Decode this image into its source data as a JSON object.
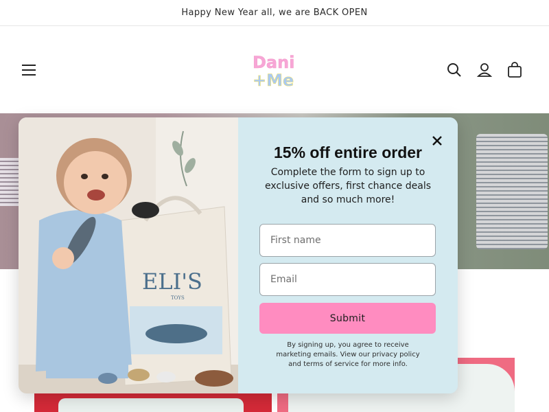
{
  "announcement": {
    "text": "Happy New Year all, we are BACK OPEN"
  },
  "header": {
    "logo_line1": "Dani",
    "logo_line2": "+Me",
    "icons": [
      "menu-icon",
      "search-icon",
      "account-icon",
      "cart-icon"
    ]
  },
  "popup": {
    "title": "15% off entire order",
    "subtitle": "Complete the form to sign up to exclusive offers, first chance deals and so much more!",
    "first_name_placeholder": "First name",
    "email_placeholder": "Email",
    "submit_label": "Submit",
    "legal": "By signing up, you agree to receive marketing emails. View our privacy policy and terms of service for more info.",
    "image_bag_text": "ELI'S",
    "image_bag_subtext": "TOYS"
  },
  "colors": {
    "popup_bg": "#d4eaf0",
    "submit_bg": "#ff8cc0",
    "logo_pink": "#f7a6d6",
    "logo_blue": "#a9c9f2",
    "logo_yellow": "#f5e46a"
  }
}
